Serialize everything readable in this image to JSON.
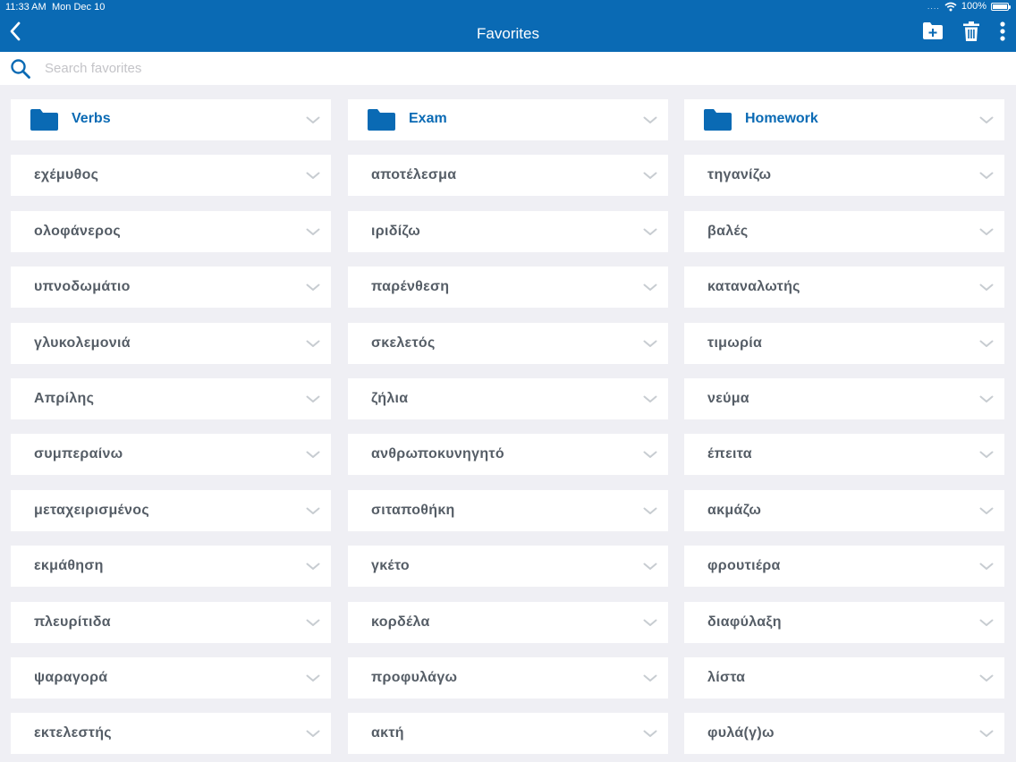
{
  "status_bar": {
    "time": "11:33 AM",
    "date": "Mon Dec 10",
    "signal": "....",
    "battery": "100%"
  },
  "header": {
    "title": "Favorites",
    "icons": {
      "back": "chevron-left-icon",
      "new_folder": "folder-add-icon",
      "delete": "trash-icon",
      "more": "more-vertical-icon"
    }
  },
  "search": {
    "placeholder": "Search favorites",
    "value": "",
    "icon": "search-icon"
  },
  "colors": {
    "brand": "#0a6ab4",
    "background": "#efeff4",
    "word_text": "#555d66",
    "chevron": "#c7ccd1"
  },
  "columns": [
    {
      "folder": "Verbs",
      "words": [
        "εχέμυθος",
        "ολοφάνερος",
        "υπνοδωμάτιο",
        "γλυκολεμονιά",
        "Απρίλης",
        "συμπεραίνω",
        "μεταχειρισμένος",
        "εκμάθηση",
        "πλευρίτιδα",
        "ψαραγορά",
        "εκτελεστής"
      ]
    },
    {
      "folder": "Exam",
      "words": [
        "αποτέλεσμα",
        "ιριδίζω",
        "παρένθεση",
        "σκελετός",
        "ζήλια",
        "ανθρωποκυνηγητό",
        "σιταποθήκη",
        "γκέτο",
        "κορδέλα",
        "προφυλάγω",
        "ακτή"
      ]
    },
    {
      "folder": "Homework",
      "words": [
        "τηγανίζω",
        "βαλές",
        "καταναλωτής",
        "τιμωρία",
        "νεύμα",
        "έπειτα",
        "ακμάζω",
        "φρουτιέρα",
        "διαφύλαξη",
        "λίστα",
        "φυλά(γ)ω"
      ]
    }
  ]
}
